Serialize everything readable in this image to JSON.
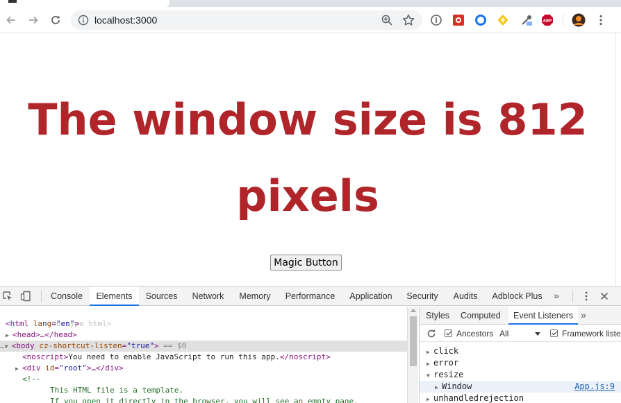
{
  "browser": {
    "url": "localhost:3000"
  },
  "page": {
    "heading": "The window size is 812 pixels",
    "button_label": "Magic Button"
  },
  "devtools": {
    "tabs": [
      "Console",
      "Elements",
      "Sources",
      "Network",
      "Memory",
      "Performance",
      "Application",
      "Security",
      "Audits",
      "Adblock Plus"
    ],
    "active_tab": "Elements",
    "more_glyph": "»",
    "elements": {
      "lines": [
        {
          "doctype": "<!doctype html>"
        },
        {
          "open": "<html",
          "attr": "lang",
          "val": "\"en\"",
          "close": ">"
        },
        {
          "tri": "▶",
          "tag": "<head>…</head>"
        },
        {
          "tri": "▼",
          "open": "<body",
          "attr": "cz-shortcut-listen",
          "val": "\"true\"",
          "close": ">",
          "dim": " == $0",
          "prefix": "…"
        },
        {
          "tag_open": "<noscript>",
          "text": "You need to enable JavaScript to run this app.",
          "tag_close": "</noscript>"
        },
        {
          "tri": "▶",
          "open": "<div",
          "attr": "id",
          "val": "\"root\"",
          "close": ">…</div>"
        },
        {
          "comment": "<!--"
        },
        {
          "comment": "This HTML file is a template."
        },
        {
          "comment": "If you open it directly in the browser, you will see an empty page."
        }
      ]
    },
    "sidebar": {
      "tabs": [
        "Styles",
        "Computed",
        "Event Listeners"
      ],
      "active_tab": "Event Listeners",
      "ancestors_label": "Ancestors",
      "filter_value": "All",
      "framework_label": "Framework listeners",
      "events": [
        {
          "name": "click",
          "expanded": false
        },
        {
          "name": "error",
          "expanded": false
        },
        {
          "name": "resize",
          "expanded": true
        },
        {
          "name": "Window",
          "sub": true,
          "link": "App.js:9"
        },
        {
          "name": "unhandledrejection",
          "expanded": false
        }
      ]
    }
  }
}
